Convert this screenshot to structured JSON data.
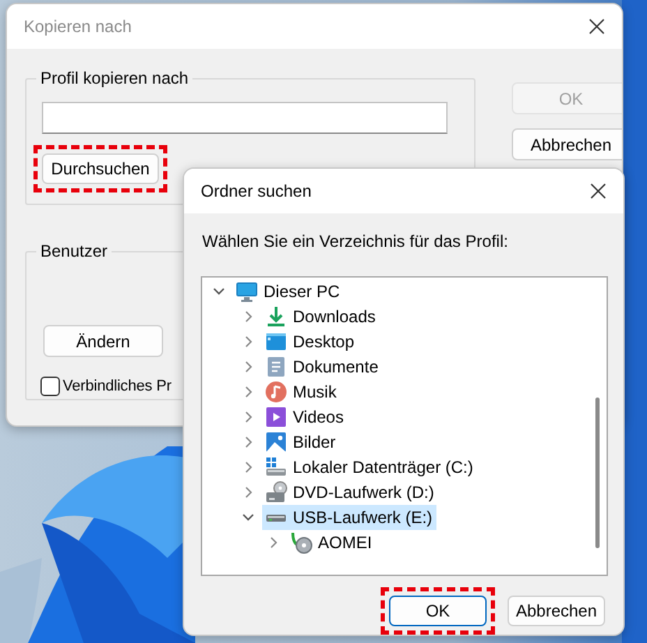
{
  "main_window": {
    "title": "Kopieren nach",
    "target_group": {
      "label": "Profil kopieren nach",
      "browse_button": {
        "label": "Durchsuchen",
        "highlighted": true
      }
    },
    "user_group": {
      "label": "Benutzer",
      "change_button": {
        "label": "Ändern"
      },
      "checkbox": {
        "label": "Verbindliches Pr",
        "checked": false
      }
    },
    "buttons": [
      {
        "label": "OK",
        "disabled": true
      },
      {
        "label": "Abbrechen",
        "disabled": false
      }
    ]
  },
  "folder_dialog": {
    "title": "Ordner suchen",
    "prompt": "Wählen Sie ein Verzeichnis für das Profil:",
    "tree": [
      {
        "label": "Dieser PC",
        "kind": "computer",
        "expanded": true,
        "selected": false,
        "children": [
          {
            "label": "Downloads",
            "kind": "downloads",
            "expanded": false,
            "selected": false
          },
          {
            "label": "Desktop",
            "kind": "desktop",
            "expanded": false,
            "selected": false
          },
          {
            "label": "Dokumente",
            "kind": "documents",
            "expanded": false,
            "selected": false
          },
          {
            "label": "Musik",
            "kind": "music",
            "expanded": false,
            "selected": false
          },
          {
            "label": "Videos",
            "kind": "videos",
            "expanded": false,
            "selected": false
          },
          {
            "label": "Bilder",
            "kind": "pictures",
            "expanded": false,
            "selected": false
          },
          {
            "label": "Lokaler Datenträger (C:)",
            "kind": "disk",
            "expanded": false,
            "selected": false
          },
          {
            "label": "DVD-Laufwerk (D:)",
            "kind": "dvd",
            "expanded": false,
            "selected": false
          },
          {
            "label": "USB-Laufwerk (E:)",
            "kind": "usb",
            "expanded": true,
            "selected": true,
            "children": [
              {
                "label": "AOMEI",
                "kind": "shared",
                "expanded": false,
                "selected": false
              }
            ]
          }
        ]
      }
    ],
    "buttons": [
      {
        "label": "OK",
        "default": true,
        "highlighted": true
      },
      {
        "label": "Abbrechen",
        "default": false,
        "highlighted": false
      }
    ]
  }
}
